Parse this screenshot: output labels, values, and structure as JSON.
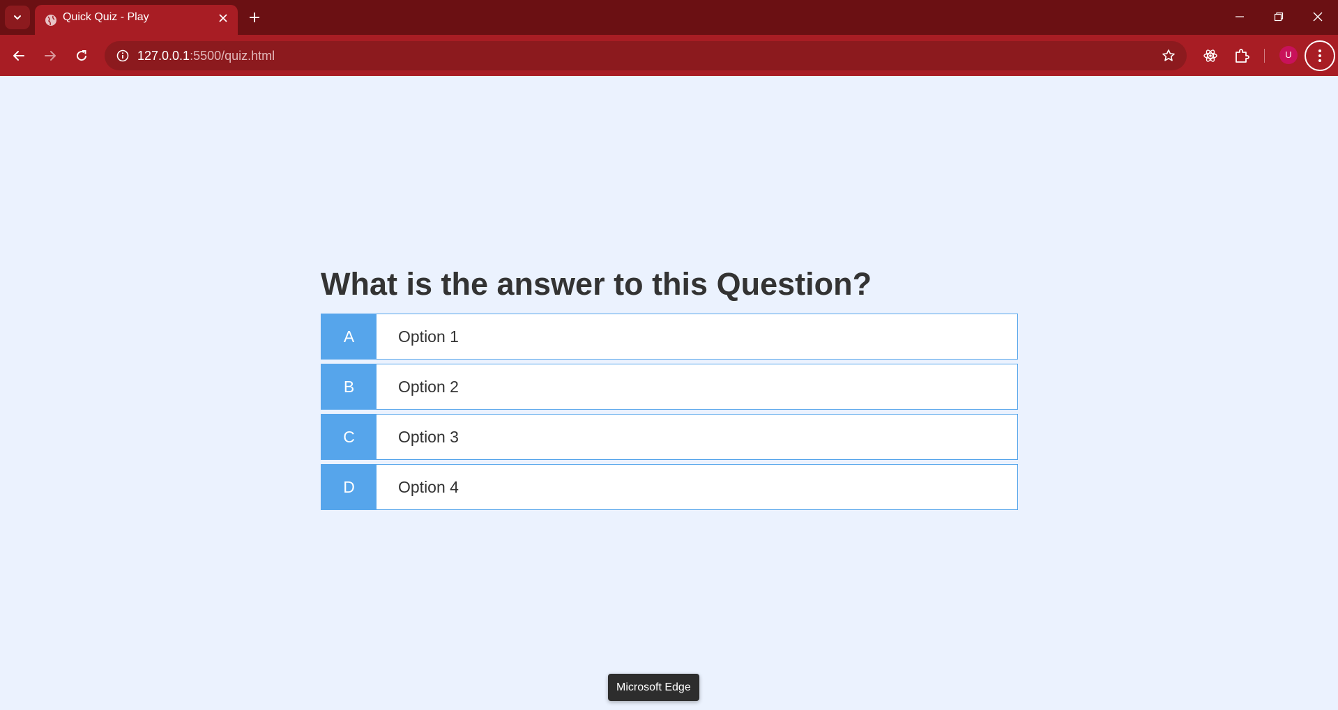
{
  "browser": {
    "tab": {
      "title": "Quick Quiz - Play"
    },
    "address_bar": {
      "host": "127.0.0.1",
      "path": ":5500/quiz.html"
    },
    "profile_initial": "U",
    "colors": {
      "frame": "#6b1013",
      "toolbar": "#a81d24",
      "omnibox": "#8c1a1e"
    }
  },
  "quiz": {
    "question": "What is the answer to this Question?",
    "choices": [
      {
        "prefix": "A",
        "text": "Option 1"
      },
      {
        "prefix": "B",
        "text": "Option 2"
      },
      {
        "prefix": "C",
        "text": "Option 3"
      },
      {
        "prefix": "D",
        "text": "Option 4"
      }
    ],
    "colors": {
      "accent": "#56a5eb",
      "background": "#ebf2fe",
      "text": "#333333"
    }
  },
  "tooltip": {
    "text": "Microsoft Edge"
  }
}
